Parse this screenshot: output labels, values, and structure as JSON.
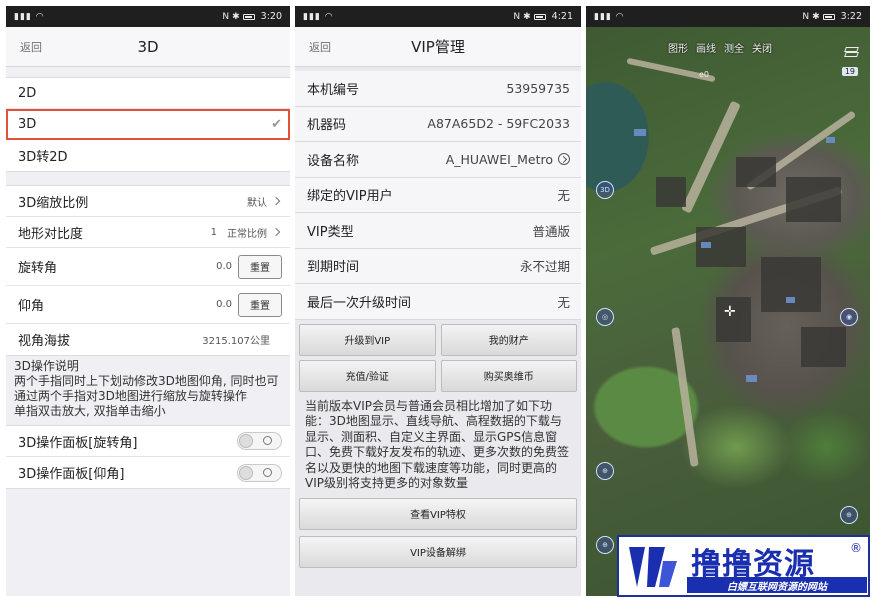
{
  "screen1": {
    "status": {
      "network": "4G",
      "speed": "23\nK/s",
      "time": "3:20"
    },
    "nav": {
      "back": "返回",
      "title": "3D"
    },
    "modes": [
      {
        "label": "2D"
      },
      {
        "label": "3D",
        "selected": true
      },
      {
        "label": "3D转2D"
      }
    ],
    "settings": {
      "scale": {
        "label": "3D缩放比例",
        "value": "默认"
      },
      "contrast": {
        "label": "地形对比度",
        "value": "1",
        "value2": "正常比例"
      },
      "rotation": {
        "label": "旋转角",
        "value": "0.0",
        "button": "重置"
      },
      "pitch": {
        "label": "仰角",
        "value": "0.0",
        "button": "重置"
      },
      "altitude": {
        "label": "视角海拔",
        "value": "3215.107公里"
      }
    },
    "instructions": {
      "title": "3D操作说明",
      "body": "两个手指同时上下划动修改3D地图仰角, 同时也可通过两个手指对3D地图进行缩放与旋转操作",
      "tip": "单指双击放大, 双指单击缩小"
    },
    "toggles": [
      {
        "label": "3D操作面板[旋转角]"
      },
      {
        "label": "3D操作面板[仰角]"
      }
    ]
  },
  "screen2": {
    "status": {
      "speed": "29.6\nK/s",
      "time": "4:21"
    },
    "nav": {
      "back": "返回",
      "title": "VIP管理"
    },
    "rows": [
      {
        "label": "本机编号",
        "value": "53959735"
      },
      {
        "label": "机器码",
        "value": "A87A65D2 - 59FC2033"
      },
      {
        "label": "设备名称",
        "value": "A_HUAWEI_Metro"
      },
      {
        "label": "绑定的VIP用户",
        "value": "无"
      },
      {
        "label": "VIP类型",
        "value": "普通版"
      },
      {
        "label": "到期时间",
        "value": "永不过期"
      },
      {
        "label": "最后一次升级时间",
        "value": "无"
      }
    ],
    "buttons": {
      "upgrade": "升级到VIP",
      "assets": "我的财产",
      "recharge": "充值/验证",
      "buy": "购买奥维币"
    },
    "description": "当前版本VIP会员与普通会员相比增加了如下功能：3D地图显示、直线导航、高程数据的下载与显示、测面积、自定义主界面、显示GPS信息窗口、免费下载好友发布的轨迹、更多次数的免费签名以及更快的地图下载速度等功能，同时更高的VIP级别将支持更多的对象数量",
    "view_privileges": "查看VIP特权",
    "unbind": "VIP设备解绑"
  },
  "screen3": {
    "status": {
      "speed": "145\nK/s",
      "time": "3:22"
    },
    "toolbar": [
      "图形",
      "画线",
      "测全",
      "关闭"
    ],
    "side_3d": "3D",
    "scale_tag": "19",
    "map_label": "e0"
  },
  "watermark": {
    "title": "撸撸资源",
    "reg": "®",
    "subtitle": "白嫖互联网资源的网站"
  },
  "colors": {
    "selection_outline": "#e25238",
    "watermark_blue": "#1a2fb0"
  }
}
